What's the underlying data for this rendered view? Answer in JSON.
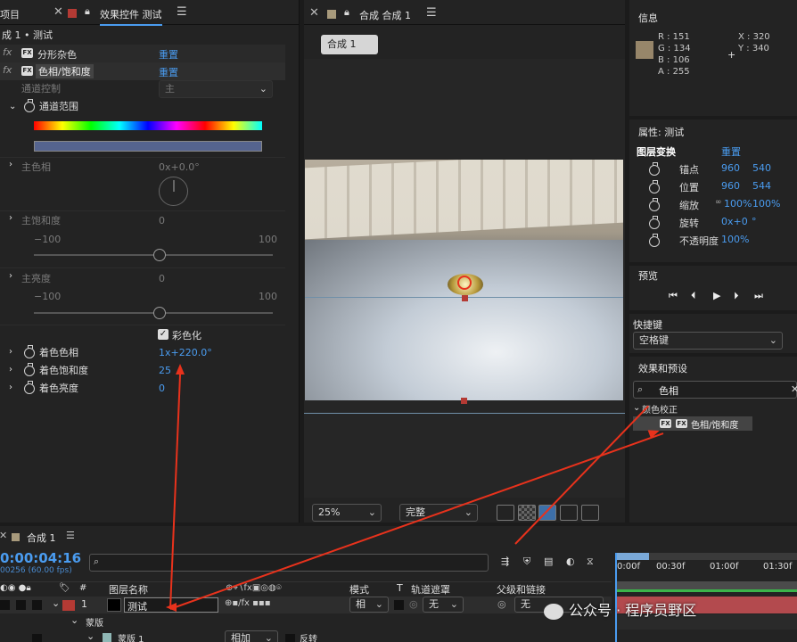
{
  "effect_panel": {
    "project_tab": "项目",
    "tab_title": "效果控件 测试",
    "breadcrumb": "成 1 • 测试",
    "fx_label": "fx",
    "effect1_name": "分形杂色",
    "effect1_reset": "重置",
    "effect2_name": "色相/饱和度",
    "effect2_reset": "重置",
    "channel_control_label": "通道控制",
    "channel_control_value": "主",
    "channel_range_label": "通道范围",
    "master_hue_label": "主色相",
    "master_hue_value": "0x+0.0°",
    "master_sat_label": "主饱和度",
    "master_sat_value": "0",
    "master_sat_min": "−100",
    "master_sat_max": "100",
    "master_light_label": "主亮度",
    "master_light_value": "0",
    "master_light_min": "−100",
    "master_light_max": "100",
    "colorize_label": "彩色化",
    "colorize_hue_label": "着色色相",
    "colorize_hue_value": "1x+220.0°",
    "colorize_sat_label": "着色饱和度",
    "colorize_sat_value": "25",
    "colorize_light_label": "着色亮度",
    "colorize_light_value": "0"
  },
  "comp_panel": {
    "tab_title": "合成 合成 1",
    "comp_button": "合成 1",
    "zoom": "25%",
    "quality": "完整"
  },
  "info_panel": {
    "title": "信息",
    "r": "R : 151",
    "g": "G : 134",
    "b": "B : 106",
    "a": "A : 255",
    "x": "X : 320",
    "y": "Y : 340",
    "color": "#97866a"
  },
  "properties_panel": {
    "title": "属性: 测试",
    "section": "图层变换",
    "reset": "重置",
    "anchor_label": "锚点",
    "anchor_x": "960",
    "anchor_y": "540",
    "position_label": "位置",
    "position_x": "960",
    "position_y": "544",
    "scale_label": "缩放",
    "scale_x": "100%",
    "scale_y": "100%",
    "rotation_label": "旋转",
    "rotation_value": "0x+0",
    "rotation_unit": "°",
    "opacity_label": "不透明度",
    "opacity_value": "100%"
  },
  "preview_panel": {
    "title": "预览"
  },
  "shortcut_panel": {
    "title": "快捷键",
    "value": "空格键"
  },
  "effects_presets_panel": {
    "title": "效果和预设",
    "search_value": "色相",
    "category": "颜色校正",
    "item": "色相/饱和度"
  },
  "timeline": {
    "tab_title": "合成 1",
    "timecode": "0:00:04:16",
    "frames": "00256 (60.00 fps)",
    "col_layer_name": "图层名称",
    "col_mode": "模式",
    "col_t": "T",
    "col_track_matte": "轨道遮罩",
    "col_parent": "父级和链接",
    "layer_number": "1",
    "layer_name": "测试",
    "layer_mode": "相",
    "layer_matte": "无",
    "layer_parent": "无",
    "sub_mask": "蒙版",
    "sub_mask1": "蒙版 1",
    "sub_mask1_mode": "相加",
    "sub_mask1_invert": "反转",
    "ruler": [
      "0:00f",
      "00:30f",
      "01:00f",
      "01:30f"
    ]
  },
  "watermark": "公众号 · 程序员野区"
}
